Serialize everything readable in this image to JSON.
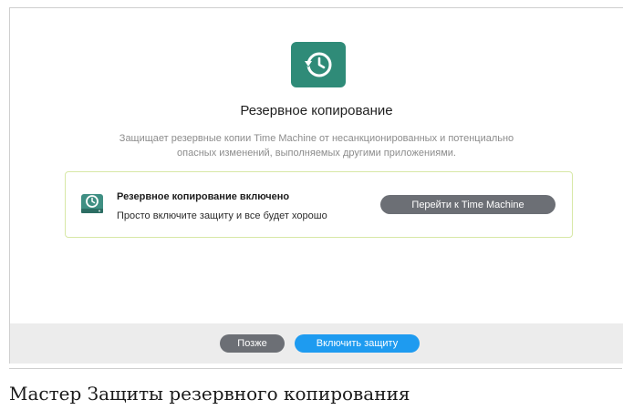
{
  "dialog": {
    "icon": "time-machine-icon",
    "title": "Резервное копирование",
    "description_line1": "Защищает резервные копии Time Machine от несанкционированных и потенциально",
    "description_line2": "опасных изменений, выполняемых другими приложениями.",
    "status_card": {
      "icon": "backup-disk-icon",
      "title": "Резервное копирование включено",
      "subtitle": "Просто включите защиту и все будет хорошо",
      "button_label": "Перейти к Time Machine"
    },
    "footer": {
      "later_label": "Позже",
      "enable_label": "Включить защиту"
    }
  },
  "caption": "Мастер Защиты резервного копирования",
  "colors": {
    "accent": "#1e9bf0",
    "icon_bg": "#2f8b78",
    "card_border": "#d7e8a6",
    "secondary_button": "#6c6f75"
  }
}
